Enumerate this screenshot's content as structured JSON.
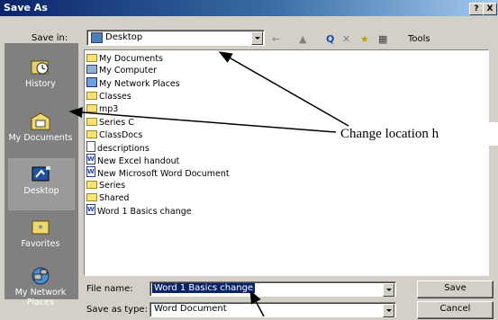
{
  "window": {
    "title": "Save As",
    "help_label": "?",
    "close_label": "X"
  },
  "location_bar": {
    "label": "Save in:",
    "value": "Desktop"
  },
  "toolbar": {
    "back_label": "←",
    "up_label": "▲",
    "search_label": "Q",
    "delete_label": "✕",
    "new_folder_label": "★",
    "views_label": "▦",
    "tools_label": "Tools"
  },
  "places": [
    {
      "label": "History",
      "icon": "history-icon"
    },
    {
      "label": "My Documents",
      "icon": "my-documents-icon"
    },
    {
      "label": "Desktop",
      "icon": "desktop-icon"
    },
    {
      "label": "Favorites",
      "icon": "favorites-icon"
    },
    {
      "label": "My Network Places",
      "icon": "network-places-icon"
    }
  ],
  "files": [
    {
      "name": "My Documents",
      "icon": "folder"
    },
    {
      "name": "My Computer",
      "icon": "comp"
    },
    {
      "name": "My Network Places",
      "icon": "net"
    },
    {
      "name": "Classes",
      "icon": "folder"
    },
    {
      "name": "mp3",
      "icon": "folder"
    },
    {
      "name": "Series C",
      "icon": "folder"
    },
    {
      "name": "ClassDocs",
      "icon": "folder"
    },
    {
      "name": "descriptions",
      "icon": "doc"
    },
    {
      "name": "New Excel handout",
      "icon": "word"
    },
    {
      "name": "New Microsoft Word Document",
      "icon": "word"
    },
    {
      "name": "Series",
      "icon": "folder"
    },
    {
      "name": "Shared",
      "icon": "folder"
    },
    {
      "name": "Word 1 Basics change",
      "icon": "word"
    }
  ],
  "file_name": {
    "label": "File name:",
    "value": "Word 1 Basics change"
  },
  "save_as_type": {
    "label": "Save as type:",
    "value": "Word Document"
  },
  "buttons": {
    "save": "Save",
    "cancel": "Cancel"
  },
  "annotation": {
    "text": "Change location h"
  }
}
